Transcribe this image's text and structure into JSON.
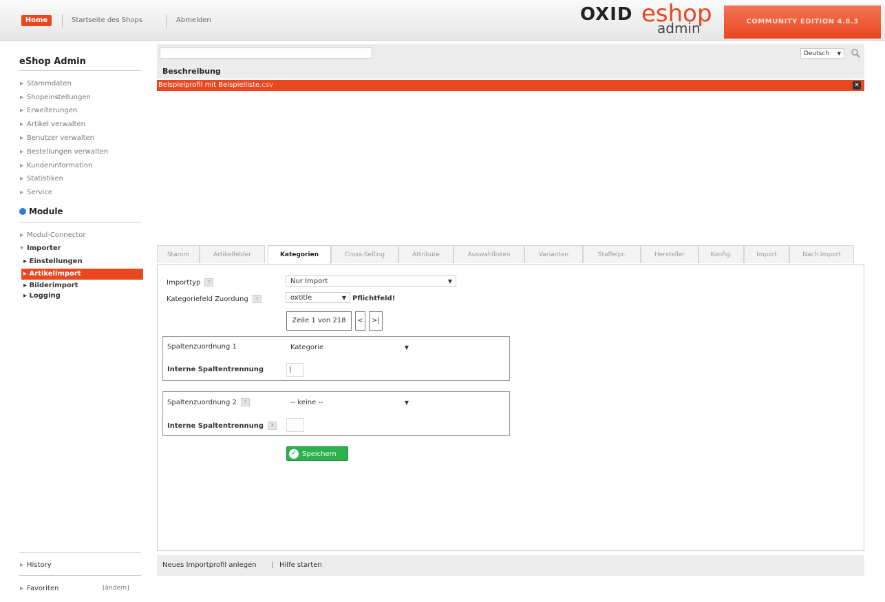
{
  "header": {
    "home": "Home",
    "shop_start": "Startseite des Shops",
    "logout": "Abmelden",
    "brand_oxid": "OXID",
    "brand_eshop": "eshop",
    "brand_admin": "admin",
    "edition": "COMMUNITY EDITION 4.8.3"
  },
  "sidebar": {
    "title": "eShop Admin",
    "items": [
      {
        "label": "Stammdaten"
      },
      {
        "label": "Shopeinstellungen"
      },
      {
        "label": "Erweiterungen"
      },
      {
        "label": "Artikel verwalten"
      },
      {
        "label": "Benutzer verwalten"
      },
      {
        "label": "Bestellungen verwalten"
      },
      {
        "label": "Kundeninformation"
      },
      {
        "label": "Statistiken"
      },
      {
        "label": "Service"
      }
    ],
    "module_title": "Module",
    "module_items": [
      {
        "label": "Modul-Connector"
      },
      {
        "label": "Importer"
      }
    ],
    "importer_items": [
      {
        "label": "Einstellungen"
      },
      {
        "label": "Artikelimport"
      },
      {
        "label": "Bilderimport"
      },
      {
        "label": "Logging"
      }
    ],
    "history": "History",
    "favorites": "Favoriten",
    "favorites_edit": "[ändern]"
  },
  "list": {
    "language": "Deutsch",
    "column_header": "Beschreibung",
    "active_row_text": "Beispielprofil mit Beispielliste.",
    "active_row_ext": "csv"
  },
  "tabs": [
    {
      "label": "Stamm"
    },
    {
      "label": "Artikelfelder"
    },
    {
      "label": "Kategorien"
    },
    {
      "label": "Cross-Selling"
    },
    {
      "label": "Attribute"
    },
    {
      "label": "Auswahllisten"
    },
    {
      "label": "Varianten"
    },
    {
      "label": "Staffelpr."
    },
    {
      "label": "Hersteller"
    },
    {
      "label": "Konfig."
    },
    {
      "label": "Import"
    },
    {
      "label": "Nach Import"
    }
  ],
  "form": {
    "importtyp_label": "Importtyp",
    "importtyp_value": "Nur Import",
    "katfeld_label": "Kategoriefeld Zuordung",
    "katfeld_value": "oxtitle",
    "pflicht": "Pflichtfeld!",
    "pager_text": "Zeile 1 von 218",
    "pager_prev": "<",
    "pager_next": ">|",
    "map1_label": "Spaltenzuordnung 1",
    "map1_value": "Kategorie",
    "sep1_label": "Interne Spaltentrennung",
    "sep1_value": "|",
    "map2_label": "Spaltenzuordnung 2",
    "map2_value": "-- keine --",
    "sep2_label": "Interne Spaltentrennung",
    "sep2_value": "",
    "save": "Speichern"
  },
  "footer": {
    "new_profile": "Neues Importprofil anlegen",
    "divider": "|",
    "help": "Hilfe starten"
  }
}
